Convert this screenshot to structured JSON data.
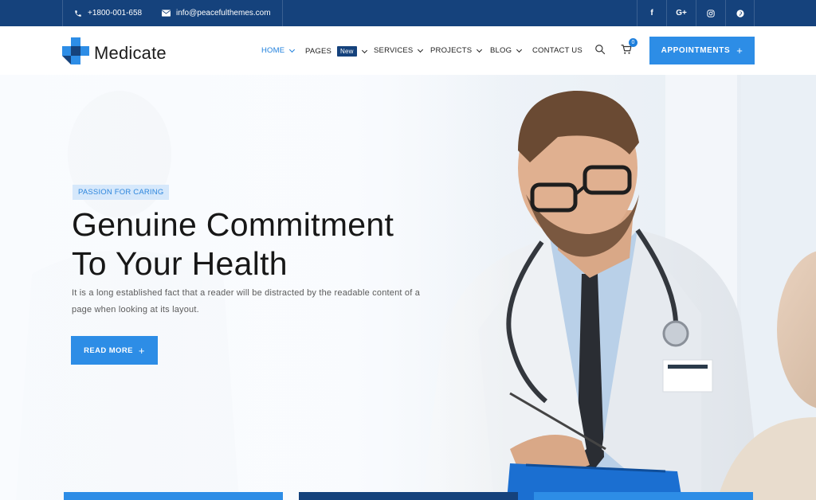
{
  "topbar": {
    "phone": "+1800-001-658",
    "email": "info@peacefulthemes.com",
    "social": [
      {
        "icon": "facebook-icon",
        "label": "f"
      },
      {
        "icon": "google-plus-icon",
        "label": "G+"
      },
      {
        "icon": "instagram-icon",
        "label": ""
      },
      {
        "icon": "pinterest-icon",
        "label": ""
      }
    ]
  },
  "header": {
    "logo_text": "Medicate",
    "nav": [
      {
        "label": "HOME",
        "active": true,
        "has_dropdown": true
      },
      {
        "label": "PAGES",
        "badge": "New",
        "has_dropdown": true
      },
      {
        "label": "SERVICES",
        "has_dropdown": true
      },
      {
        "label": "PROJECTS",
        "has_dropdown": true
      },
      {
        "label": "BLOG",
        "has_dropdown": true
      },
      {
        "label": "CONTACT US",
        "has_dropdown": false
      }
    ],
    "cart_count": "0",
    "appointments_label": "APPOINTMENTS",
    "appointments_icon": "plus-icon"
  },
  "hero": {
    "tag": "PASSION FOR CARING",
    "title_line1": "Genuine Commitment",
    "title_line2": "To Your Health",
    "description": "It is a long established fact that a reader will be distracted by the readable content of a page when looking at its layout.",
    "button_label": "READ MORE",
    "button_icon": "plus-icon"
  },
  "colors": {
    "topbar": "#15427c",
    "accent": "#2d8de6",
    "active_nav": "#1e7fdc",
    "tag_bg": "#d6e8fb",
    "heading": "#171717",
    "card_blue": "#2d8de6",
    "card_dark": "#15427c"
  }
}
